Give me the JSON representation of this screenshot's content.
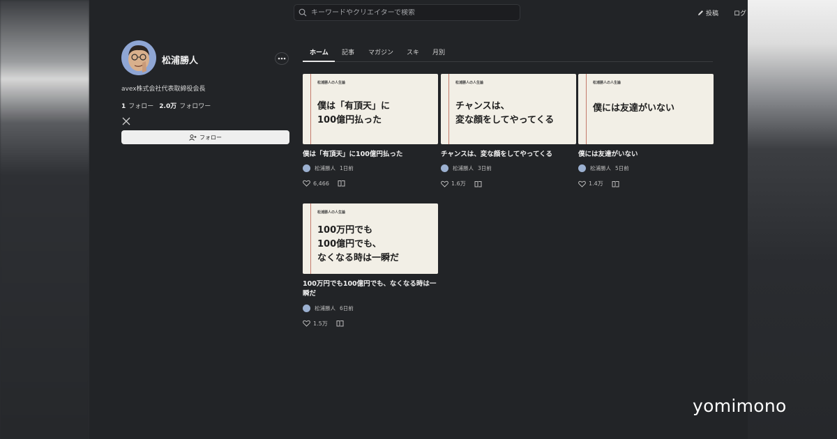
{
  "search": {
    "placeholder": "キーワードやクリエイターで検索"
  },
  "header": {
    "post_label": "投稿",
    "login_label": "ログ"
  },
  "profile": {
    "name": "松浦勝人",
    "bio": "avex株式会社代表取締役会長",
    "following_count": "1",
    "following_label": "フォロー",
    "follower_count": "2.0万",
    "follower_label": "フォロワー",
    "follow_button": "フォロー"
  },
  "tabs": [
    {
      "label": "ホーム"
    },
    {
      "label": "記事"
    },
    {
      "label": "マガジン"
    },
    {
      "label": "スキ"
    },
    {
      "label": "月別"
    }
  ],
  "articles": [
    {
      "series": "松浦勝人の人生論",
      "thumb_text": "僕は「有頂天」に\n100億円払った",
      "title": "僕は「有頂天」に100億円払った",
      "author": "松浦勝人",
      "time": "1日前",
      "likes": "6,466"
    },
    {
      "series": "松浦勝人の人生論",
      "thumb_text": "チャンスは、\n変な顔をしてやってくる",
      "title": "チャンスは、変な顔をしてやってくる",
      "author": "松浦勝人",
      "time": "3日前",
      "likes": "1.6万"
    },
    {
      "series": "松浦勝人の人生論",
      "thumb_text": "僕には友達がいない",
      "title": "僕には友達がいない",
      "author": "松浦勝人",
      "time": "5日前",
      "likes": "1.4万"
    },
    {
      "series": "松浦勝人の人生論",
      "thumb_text": "100万円でも\n100億円でも、\nなくなる時は一瞬だ",
      "title": "100万円でも100億円でも、なくなる時は一瞬だ",
      "author": "松浦勝人",
      "time": "6日前",
      "likes": "1.5万"
    }
  ],
  "watermark": "yomimono",
  "colors": {
    "background": "#222427",
    "card": "#f2efe6",
    "accent_line": "#c47a6a"
  }
}
